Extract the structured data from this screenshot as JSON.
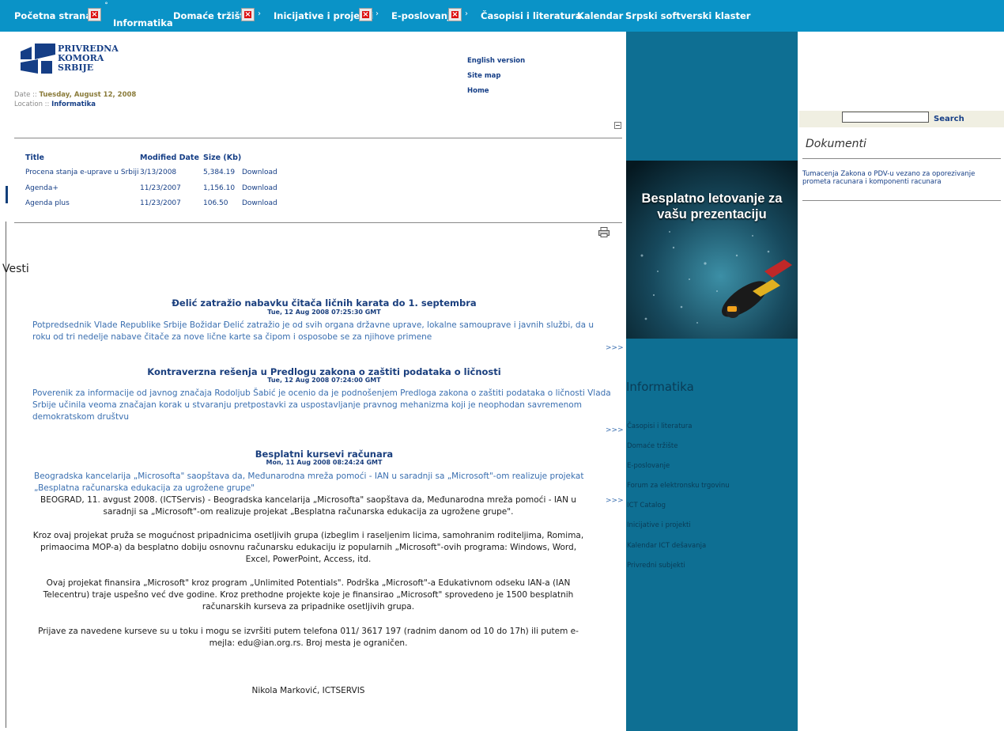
{
  "nav": {
    "items": [
      "Početna strana",
      "Informatika",
      "Domaće tržište",
      "Inicijative i projekti",
      "E-poslovanje",
      "Časopisi i literatura",
      "Kalendar",
      "Srpski softverski klaster"
    ]
  },
  "logo": {
    "line1": "PRIVREDNA",
    "line2": "KOMORA",
    "line3": "SRBIJE"
  },
  "meta": {
    "date_label": "Date ::",
    "date_value": "Tuesday, August 12, 2008",
    "location_label": "Location ::",
    "location_value": "Informatika"
  },
  "header_links": [
    "English version",
    "Site map",
    "Home"
  ],
  "docs_table": {
    "headers": [
      "Title",
      "Modified Date",
      "Size (Kb)"
    ],
    "rows": [
      {
        "title": "Procena stanja e-uprave u Srbiji",
        "date": "3/13/2008",
        "size": "5,384.19",
        "action": "Download"
      },
      {
        "title": "Agenda+",
        "date": "11/23/2007",
        "size": "1,156.10",
        "action": "Download"
      },
      {
        "title": "Agenda plus",
        "date": "11/23/2007",
        "size": "106.50",
        "action": "Download"
      }
    ]
  },
  "news": {
    "heading": "Vesti",
    "more": ">>>",
    "items": [
      {
        "title": "Đelić zatražio nabavku čitača ličnih karata do 1. septembra",
        "date": "Tue, 12 Aug 2008 07:25:30 GMT",
        "summary": "Potpredsednik Vlade Republike Srbije Božidar Đelić zatražio je od svih organa državne uprave, lokalne samouprave i javnih službi, da u roku od tri nedelje nabave čitače za nove lične karte sa čipom i osposobe se za njihove primene"
      },
      {
        "title": "Kontraverzna rešenja u Predlogu zakona o zaštiti podataka o ličnosti",
        "date": "Tue, 12 Aug 2008 07:24:00 GMT",
        "summary": "Poverenik za informacije od javnog značaja Rodoljub Šabić je ocenio da je podnošenjem Predloga zakona o zaštiti podataka o ličnosti Vlada Srbije učinila veoma značajan korak u stvaranju pretpostavki za uspostavljanje pravnog mehanizma koji je neophodan savremenom demokratskom društvu"
      },
      {
        "title": "Besplatni kursevi računara",
        "date": "Mon, 11 Aug 2008 08:24:24 GMT",
        "summary": "Beogradska kancelarija „Microsofta\" saopštava da, Međunarodna mreža pomoći - IAN u saradnji sa „Microsoft\"-om realizuje projekat „Besplatna računarska edukacija za ugrožene grupe\"",
        "paragraphs": [
          "BEOGRAD, 11. avgust 2008. (ICTServis) - Beogradska kancelarija „Microsofta\" saopštava da, Međunarodna mreža pomoći - IAN u saradnji sa „Microsoft\"-om realizuje projekat „Besplatna računarska edukacija za ugrožene grupe\".",
          "Kroz ovaj projekat pruža se mogućnost pripadnicima osetljivih grupa (izbeglim i raseljenim licima, samohranim roditeljima, Romima, primaocima MOP-a) da besplatno dobiju osnovnu računarsku edukaciju iz popularnih „Microsoft\"-ovih programa: Windows, Word, Excel, PowerPoint, Access, itd.",
          "Ovaj projekat finansira „Microsoft\" kroz program „Unlimited Potentials\". Podrška „Microsoft\"-a Edukativnom odseku IAN-a (IAN Telecentru) traje uspešno već dve godine. Kroz prethodne projekte koje je finansirao „Microsoft\" sprovedeno je 1500 besplatnih računarskih kurseva za pripadnike osetljivih grupa.",
          "Prijave za navedene kurseve su u toku i mogu se izvršiti putem telefona 011/ 3617 197 (radnim danom od 10 do 17h) ili putem e-mejla: edu@ian.org.rs. Broj mesta je ograničen.",
          "Nikola Marković, ICTSERVIS"
        ]
      }
    ]
  },
  "banner": {
    "line1": "Besplatno letovanje za",
    "line2": "vašu prezentaciju"
  },
  "sidebar": {
    "title": "Informatika",
    "items": [
      "Časopisi i literatura",
      "Domaće tržište",
      "E-poslovanje",
      "Forum za elektronsku trgovinu",
      "ICT Catalog",
      "Inicijative i projekti",
      "Kalendar ICT dešavanja",
      "Privredni subjekti"
    ]
  },
  "search": {
    "button": "Search",
    "value": ""
  },
  "dokumenti": {
    "title": "Dokumenti",
    "link": "Tumacenja Zakona o PDV-u vezano za oporezivanje prometa racunara i komponenti racunara"
  },
  "colors": {
    "nav_bg": "#0a93c7",
    "side_bg": "#0e6f93",
    "link": "#153e86",
    "news_text": "#3a6fb0"
  }
}
